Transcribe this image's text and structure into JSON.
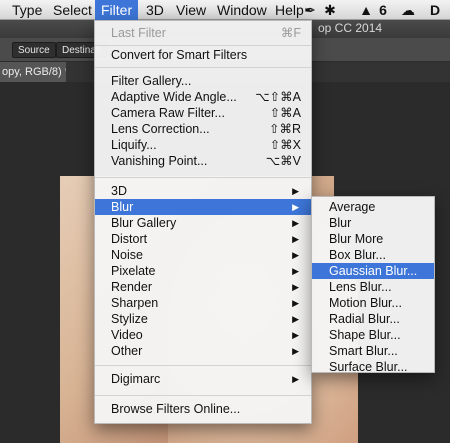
{
  "menubar": {
    "items": [
      "Type",
      "Select",
      "Filter",
      "3D",
      "View",
      "Window",
      "Help"
    ],
    "status_icons": {
      "pen_icon": "pen-nib-icon",
      "star_icon": "star-icon",
      "adobe_icon": "adobe-icon",
      "version_label": "6",
      "cc_icon": "creative-cloud-icon",
      "ds_label": "D"
    }
  },
  "app": {
    "title": "op CC 2014",
    "options_bar": {
      "source_label": "Source",
      "destination_label": "Destinati"
    },
    "doc_tab": "opy, RGB/8) *"
  },
  "filter_menu": {
    "last_filter": {
      "label": "Last Filter",
      "shortcut": "⌘F"
    },
    "convert": "Convert for Smart Filters",
    "filter_gallery": "Filter Gallery...",
    "adaptive_wide_angle": {
      "label": "Adaptive Wide Angle...",
      "shortcut": "⌥⇧⌘A"
    },
    "camera_raw": {
      "label": "Camera Raw Filter...",
      "shortcut": "⇧⌘A"
    },
    "lens_correction": {
      "label": "Lens Correction...",
      "shortcut": "⇧⌘R"
    },
    "liquify": {
      "label": "Liquify...",
      "shortcut": "⇧⌘X"
    },
    "vanishing_point": {
      "label": "Vanishing Point...",
      "shortcut": "⌥⌘V"
    },
    "submenus": [
      "3D",
      "Blur",
      "Blur Gallery",
      "Distort",
      "Noise",
      "Pixelate",
      "Render",
      "Sharpen",
      "Stylize",
      "Video",
      "Other"
    ],
    "digimarc": "Digimarc",
    "browse_online": "Browse Filters Online..."
  },
  "blur_submenu": {
    "items": [
      "Average",
      "Blur",
      "Blur More",
      "Box Blur...",
      "Gaussian Blur...",
      "Lens Blur...",
      "Motion Blur...",
      "Radial Blur...",
      "Shape Blur...",
      "Smart Blur...",
      "Surface Blur..."
    ],
    "highlighted": "Gaussian Blur..."
  },
  "colors": {
    "highlight": "#3d76d8",
    "menu_bg": "#f5f5f5",
    "app_chrome": "#4b4b4b"
  }
}
